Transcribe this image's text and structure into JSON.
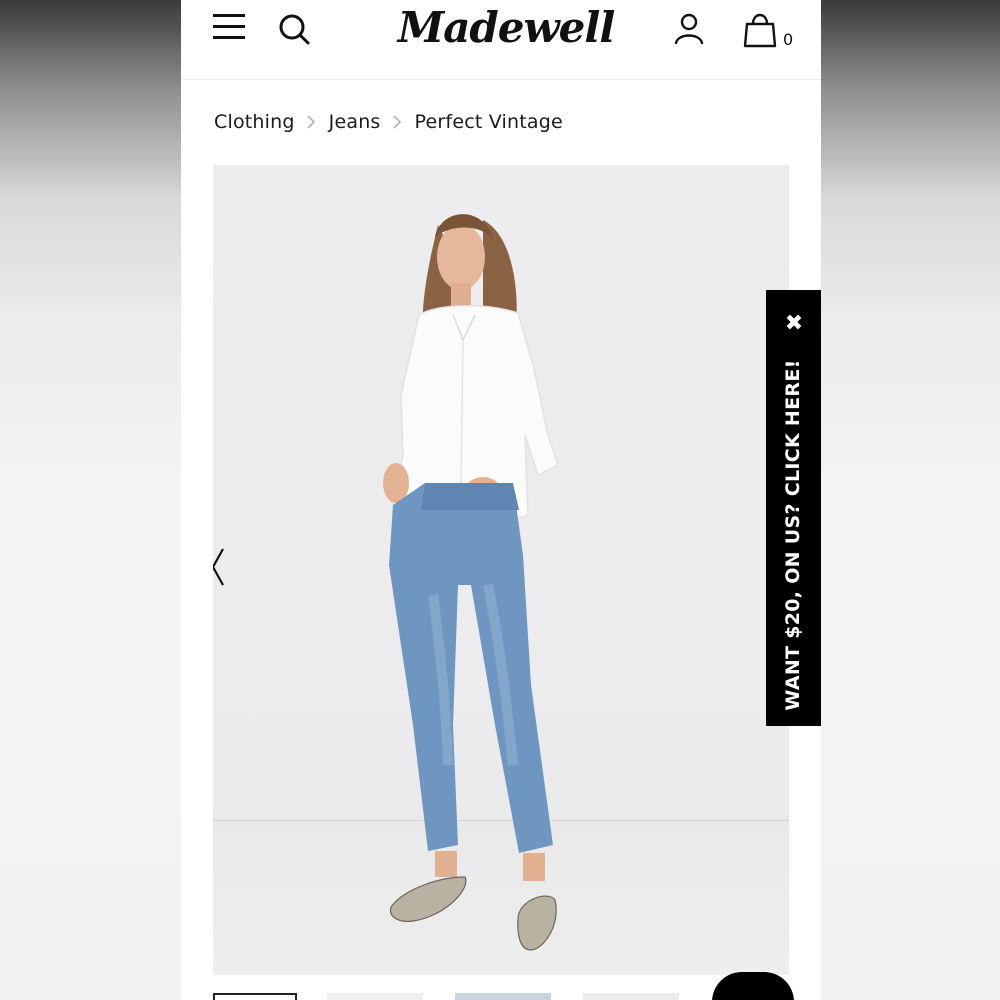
{
  "header": {
    "logo": "Madewell",
    "bag_count": "0",
    "icons": [
      "menu-icon",
      "search-icon",
      "account-icon",
      "shopping-bag-icon"
    ]
  },
  "breadcrumb": {
    "items": [
      "Clothing",
      "Jeans",
      "Perfect Vintage"
    ]
  },
  "product_image": {
    "carousel_prev_icon": "chevron-left-icon",
    "thumbnail_count": 4,
    "active_thumbnail": 1
  },
  "promo": {
    "text": "WANT $20, ON US? CLICK HERE!",
    "close_label": "✖"
  },
  "colors": {
    "page_bg": "#ffffff",
    "image_bg": "#ececee",
    "promo_bg": "#000000",
    "text": "#1a1a1a"
  }
}
